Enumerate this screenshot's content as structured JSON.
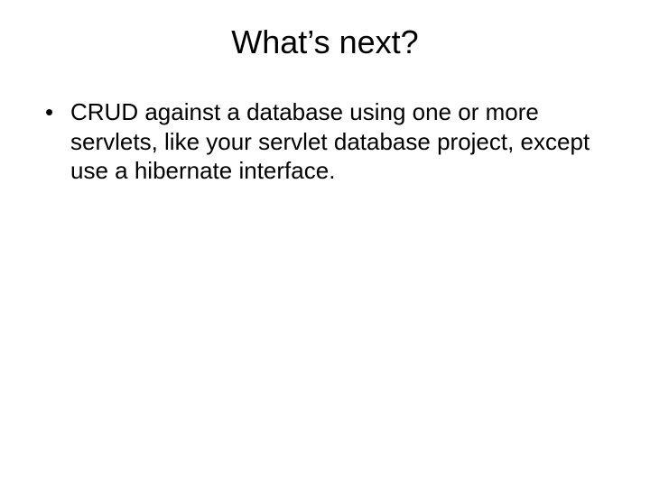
{
  "slide": {
    "title": "What’s next?",
    "bullets": [
      {
        "text": "CRUD against a database using one or more servlets, like your servlet database project, except use a hibernate interface."
      }
    ],
    "bullet_marker": "•"
  }
}
